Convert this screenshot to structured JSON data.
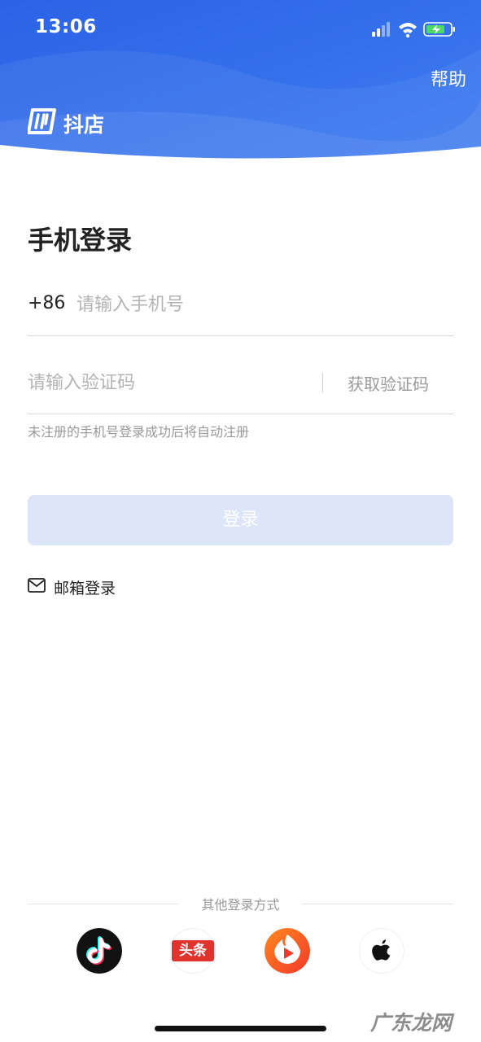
{
  "status_bar": {
    "time": "13:06"
  },
  "header": {
    "help": "帮助",
    "brand_name": "抖店",
    "accent": "#2f6be8"
  },
  "login": {
    "title": "手机登录",
    "country_code": "+86",
    "phone_placeholder": "请输入手机号",
    "code_placeholder": "请输入验证码",
    "get_code": "获取验证码",
    "hint": "未注册的手机号登录成功后将自动注册",
    "login_button": "登录",
    "email_login": "邮箱登录"
  },
  "other_login": {
    "label": "其他登录方式",
    "methods": [
      "douyin-icon",
      "toutiao-icon",
      "huoshan-icon",
      "apple-icon"
    ],
    "toutiao_text": "头条"
  },
  "watermark": "广东龙网"
}
